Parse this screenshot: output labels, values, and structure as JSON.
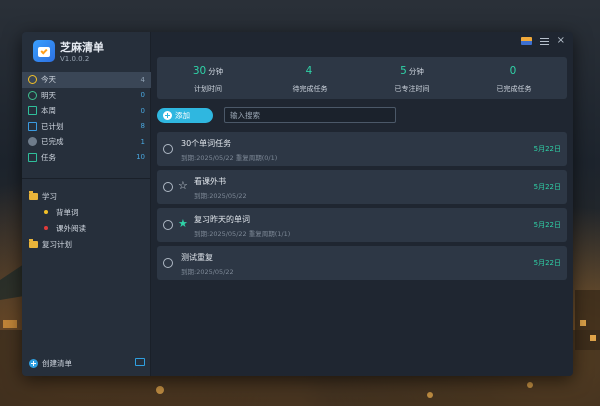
{
  "app": {
    "title": "芝麻清单",
    "version": "V1.0.0.2"
  },
  "sidebar": {
    "nav": [
      {
        "label": "今天",
        "count": "4",
        "icon": "sun-icon"
      },
      {
        "label": "明天",
        "count": "0",
        "icon": "sun-outline-icon"
      },
      {
        "label": "本周",
        "count": "0",
        "icon": "calendar-week-icon"
      },
      {
        "label": "已计划",
        "count": "8",
        "icon": "calendar-icon"
      },
      {
        "label": "已完成",
        "count": "1",
        "icon": "check-circle-icon"
      },
      {
        "label": "任务",
        "count": "10",
        "icon": "task-icon"
      }
    ],
    "lists": [
      {
        "label": "学习",
        "type": "folder"
      },
      {
        "label": "背单词",
        "type": "list",
        "color": "#f2c027"
      },
      {
        "label": "课外阅读",
        "type": "list",
        "color": "#e03a3a"
      },
      {
        "label": "复习计划",
        "type": "folder"
      }
    ],
    "create_list_label": "创建清单"
  },
  "stats": [
    {
      "value": "30",
      "unit": "分钟",
      "label": "计划时间"
    },
    {
      "value": "4",
      "unit": "",
      "label": "待完成任务"
    },
    {
      "value": "5",
      "unit": "分钟",
      "label": "已专注时间"
    },
    {
      "value": "0",
      "unit": "",
      "label": "已完成任务"
    }
  ],
  "toolbar": {
    "add_label": "添加",
    "search_placeholder": "输入搜索"
  },
  "tasks": [
    {
      "title": "30个单词任务",
      "meta": "到期:2025/05/22 重复周期(0/1)",
      "date": "5月22日",
      "starred": false,
      "show_star": false
    },
    {
      "title": "看课外书",
      "meta": "到期:2025/05/22",
      "date": "5月22日",
      "starred": false,
      "show_star": true
    },
    {
      "title": "复习昨天的单词",
      "meta": "到期:2025/05/22 重复周期(1/1)",
      "date": "5月22日",
      "starred": true,
      "show_star": true
    },
    {
      "title": "测试重复",
      "meta": "到期:2025/05/22",
      "date": "5月22日",
      "starred": false,
      "show_star": false
    }
  ],
  "colors": {
    "accent": "#2fd3a8",
    "button": "#2fb7e0",
    "active_nav": "#3a4656"
  }
}
